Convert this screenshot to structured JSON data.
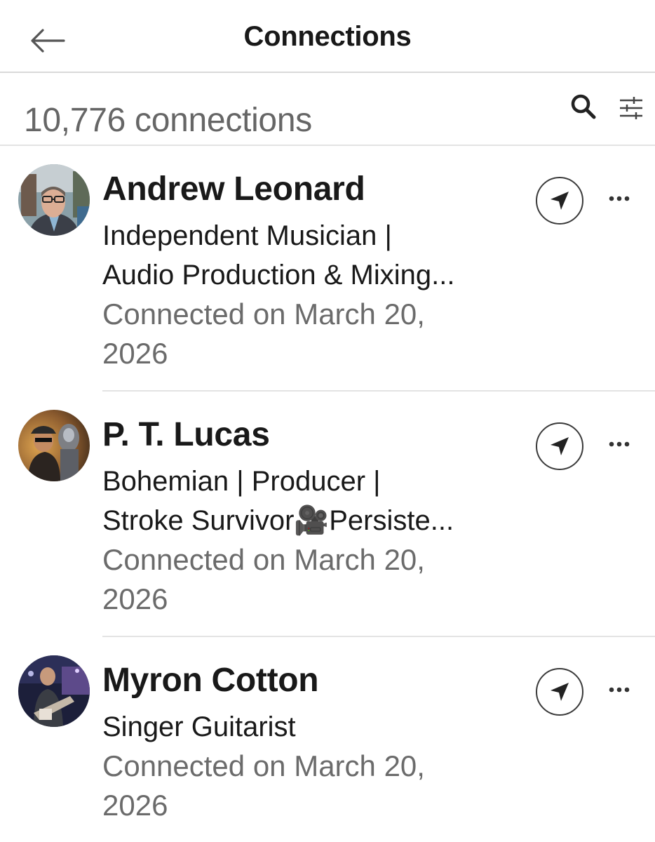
{
  "header": {
    "title": "Connections",
    "back_icon": "arrow-left-icon"
  },
  "summary": {
    "count_text": "10,776 connections",
    "search_icon": "search-icon",
    "filter_icon": "sliders-icon"
  },
  "connections": [
    {
      "name": "Andrew Leonard",
      "headline_line1": "Independent Musician |",
      "headline_line2": "Audio Production & Mixing...",
      "connected_line1": "Connected on March 20,",
      "connected_line2": "2026",
      "message_icon": "send-icon",
      "more_icon": "ellipsis-icon"
    },
    {
      "name": "P. T. Lucas",
      "headline_line1": "Bohemian | Producer |",
      "headline_line2": "Stroke Survivor🎥Persiste...",
      "connected_line1": "Connected on March 20,",
      "connected_line2": "2026",
      "message_icon": "send-icon",
      "more_icon": "ellipsis-icon"
    },
    {
      "name": "Myron Cotton",
      "headline_line1": "Singer Guitarist",
      "connected_line1": "Connected on March 20,",
      "connected_line2": "2026",
      "message_icon": "send-icon",
      "more_icon": "ellipsis-icon"
    }
  ]
}
